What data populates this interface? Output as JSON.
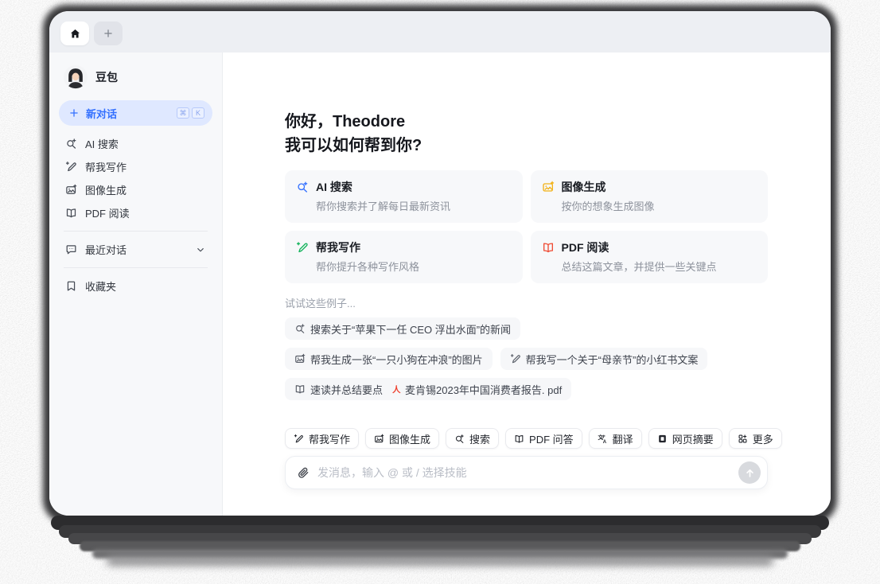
{
  "tabbar": {
    "home_tab": "home",
    "new_tab_label": "+"
  },
  "sidebar": {
    "profile": {
      "name": "豆包",
      "avatar": "girl-avatar"
    },
    "new_chat": {
      "label": "新对话",
      "icon": "plus-icon",
      "shortcut_keys": [
        "⌘",
        "K"
      ]
    },
    "items": [
      {
        "label": "AI 搜索",
        "icon": "ai-search-icon"
      },
      {
        "label": "帮我写作",
        "icon": "write-icon"
      },
      {
        "label": "图像生成",
        "icon": "image-icon"
      },
      {
        "label": "PDF 阅读",
        "icon": "book-icon"
      }
    ],
    "recent": {
      "label": "最近对话",
      "icon": "chat-bubble-icon",
      "chevron": "chevron-down-icon"
    },
    "favorites": {
      "label": "收藏夹",
      "icon": "bookmark-icon"
    }
  },
  "main": {
    "greeting_line1": "你好，Theodore",
    "greeting_line2": "我可以如何帮到你?",
    "cards": [
      {
        "title": "AI 搜索",
        "desc": "帮你搜索并了解每日最新资讯",
        "icon": "ai-search-icon",
        "color": "#3370ff"
      },
      {
        "title": "图像生成",
        "desc": "按你的想象生成图像",
        "icon": "image-icon",
        "color": "#f2b115"
      },
      {
        "title": "帮我写作",
        "desc": "帮你提升各种写作风格",
        "icon": "write-icon",
        "color": "#10b259"
      },
      {
        "title": "PDF 阅读",
        "desc": "总结这篇文章，并提供一些关键点",
        "icon": "book-icon",
        "color": "#ef4b33"
      }
    ],
    "examples_label": "试试这些例子...",
    "examples": [
      {
        "text": "搜索关于“苹果下一任 CEO 浮出水面”的新闻",
        "icon": "ai-search-icon"
      },
      {
        "text": "帮我生成一张“一只小狗在冲浪”的图片",
        "icon": "image-icon"
      },
      {
        "text": "帮我写一个关于“母亲节”的小红书文案",
        "icon": "write-icon"
      },
      {
        "text_prefix": "速读并总结要点",
        "file_name": "麦肯锡2023年中国消费者报告. pdf",
        "icon": "book-icon",
        "file_icon": "adobe-pdf-icon"
      }
    ],
    "toolbar": [
      {
        "label": "帮我写作",
        "icon": "write-icon"
      },
      {
        "label": "图像生成",
        "icon": "image-icon"
      },
      {
        "label": "搜索",
        "icon": "ai-search-icon"
      },
      {
        "label": "PDF 问答",
        "icon": "book-icon"
      },
      {
        "label": "翻译",
        "icon": "translate-icon"
      },
      {
        "label": "网页摘要",
        "icon": "webpage-icon"
      },
      {
        "label": "更多",
        "icon": "more-grid-icon"
      }
    ],
    "input": {
      "placeholder": "发消息，输入 @ 或 / 选择技能",
      "attach_icon": "paperclip-icon",
      "send_icon": "arrow-up-icon"
    }
  },
  "colors": {
    "accent_blue": "#3370ff",
    "new_chat_bg": "#dfe8ff",
    "tabbar_bg": "#edeff3",
    "sidebar_bg": "#f7f8fa",
    "card_bg": "#f7f8fa",
    "icon_yellow": "#f2b115",
    "icon_green": "#10b259",
    "icon_red": "#ef4b33",
    "pdf_logo_red": "#ee3f2d",
    "send_btn_bg": "#d8dade"
  }
}
